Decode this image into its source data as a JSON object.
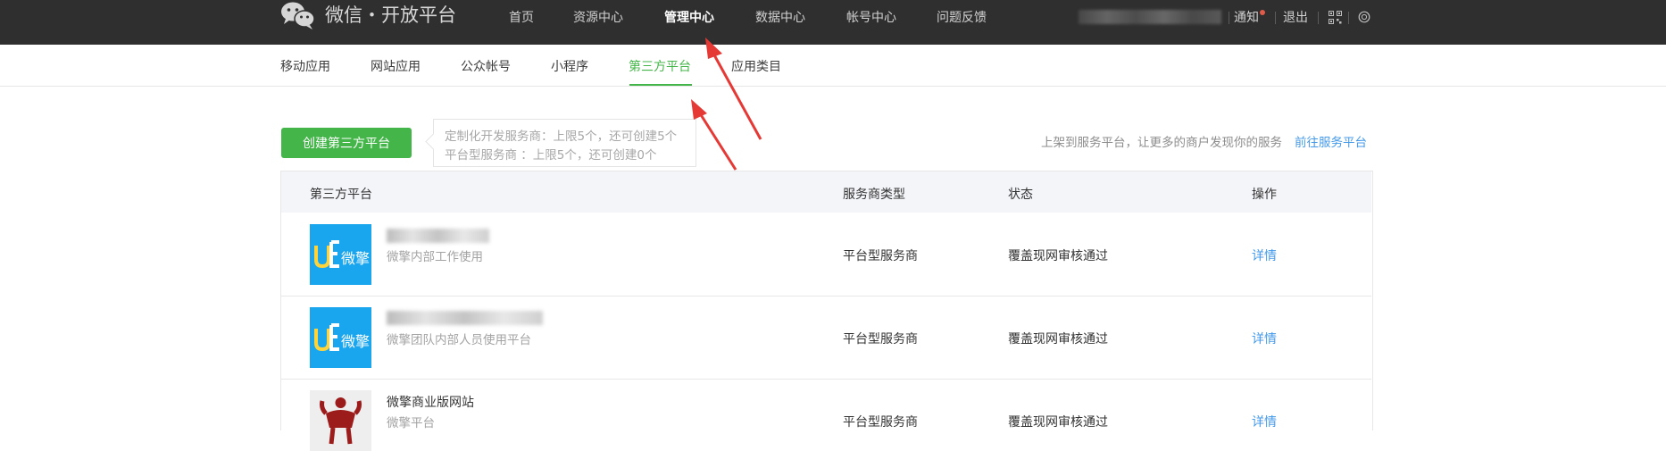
{
  "header": {
    "brand": "微信・开放平台",
    "nav": [
      {
        "label": "首页"
      },
      {
        "label": "资源中心"
      },
      {
        "label": "管理中心",
        "active": true
      },
      {
        "label": "数据中心"
      },
      {
        "label": "帐号中心"
      },
      {
        "label": "问题反馈"
      }
    ],
    "notify_label": "通知",
    "logout_label": "退出",
    "qrcode_icon": "qrcode-icon",
    "language_icon": "globe-icon"
  },
  "subnav": [
    {
      "label": "移动应用"
    },
    {
      "label": "网站应用"
    },
    {
      "label": "公众帐号"
    },
    {
      "label": "小程序"
    },
    {
      "label": "第三方平台",
      "active": true
    },
    {
      "label": "应用类目"
    }
  ],
  "toolbar": {
    "create_label": "创建第三方平台",
    "tip_line1": "定制化开发服务商：上限5个，还可创建5个",
    "tip_line2": "平台型服务商 ：上限5个，还可创建0个",
    "promo_text": "上架到服务平台，让更多的商户发现你的服务",
    "promo_link": "前往服务平台"
  },
  "table": {
    "columns": [
      "第三方平台",
      "服务商类型",
      "状态",
      "操作"
    ],
    "rows": [
      {
        "name": "",
        "desc": "微擎内部工作使用",
        "type": "平台型服务商",
        "status": "覆盖现网审核通过",
        "action": "详情",
        "thumb": "weiqing-logo"
      },
      {
        "name": "",
        "desc": "微擎团队内部人员使用平台",
        "type": "平台型服务商",
        "status": "覆盖现网审核通过",
        "action": "详情",
        "thumb": "weiqing-logo"
      },
      {
        "name": "微擎商业版网站",
        "desc": "微擎平台",
        "type": "平台型服务商",
        "status": "覆盖现网审核通过",
        "action": "详情",
        "thumb": "strongman-logo"
      }
    ]
  },
  "logo_text": "微擎",
  "colors": {
    "topbar": "#2f2f2f",
    "accent_green": "#44b549",
    "link_blue": "#459ae9",
    "header_row": "#f4f5f9",
    "arrow_red": "#e53935"
  }
}
